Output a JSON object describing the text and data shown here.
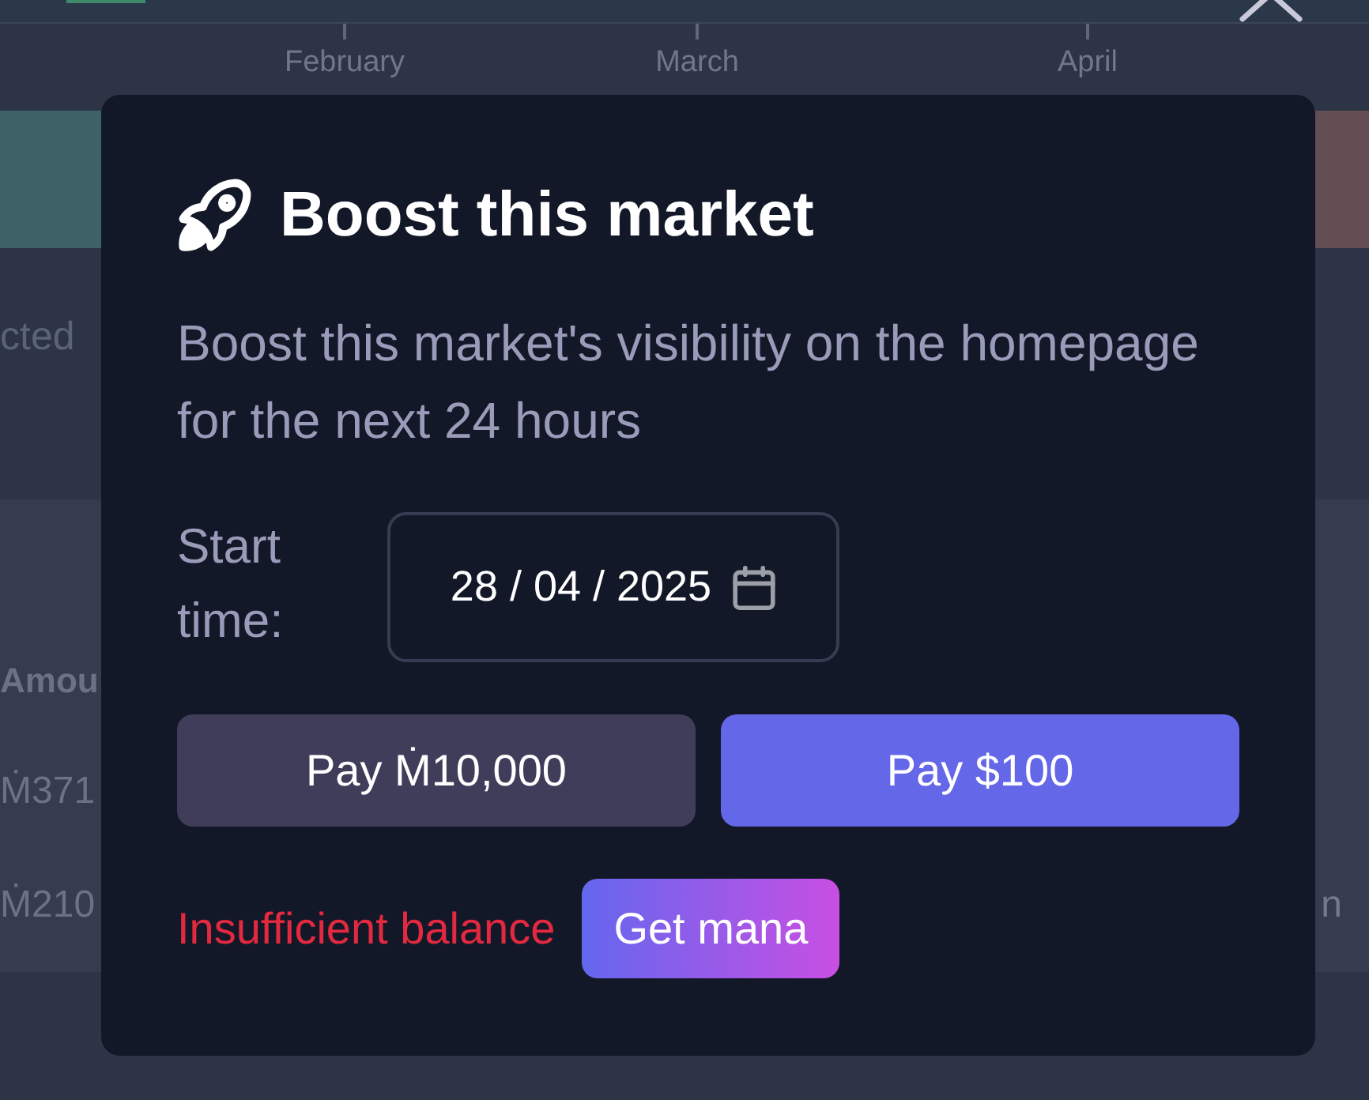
{
  "page": {
    "chart_axis": {
      "labels": [
        "February",
        "March",
        "April"
      ]
    },
    "side_text": "cted",
    "table": {
      "header": "Amou",
      "rows": [
        {
          "amount": "Ṁ371"
        },
        {
          "amount": "Ṁ210",
          "trailing": "n"
        }
      ]
    }
  },
  "dialog": {
    "title": "Boost this market",
    "description": "Boost this market's visibility on the homepage for the next 24 hours",
    "start_time": {
      "label": "Start time:",
      "value": "28 / 04 / 2025"
    },
    "pay_buttons": [
      {
        "label": "Pay Ṁ10,000",
        "kind": "secondary"
      },
      {
        "label": "Pay $100",
        "kind": "primary"
      }
    ],
    "error": "Insufficient balance",
    "get_mana_button": "Get mana"
  }
}
